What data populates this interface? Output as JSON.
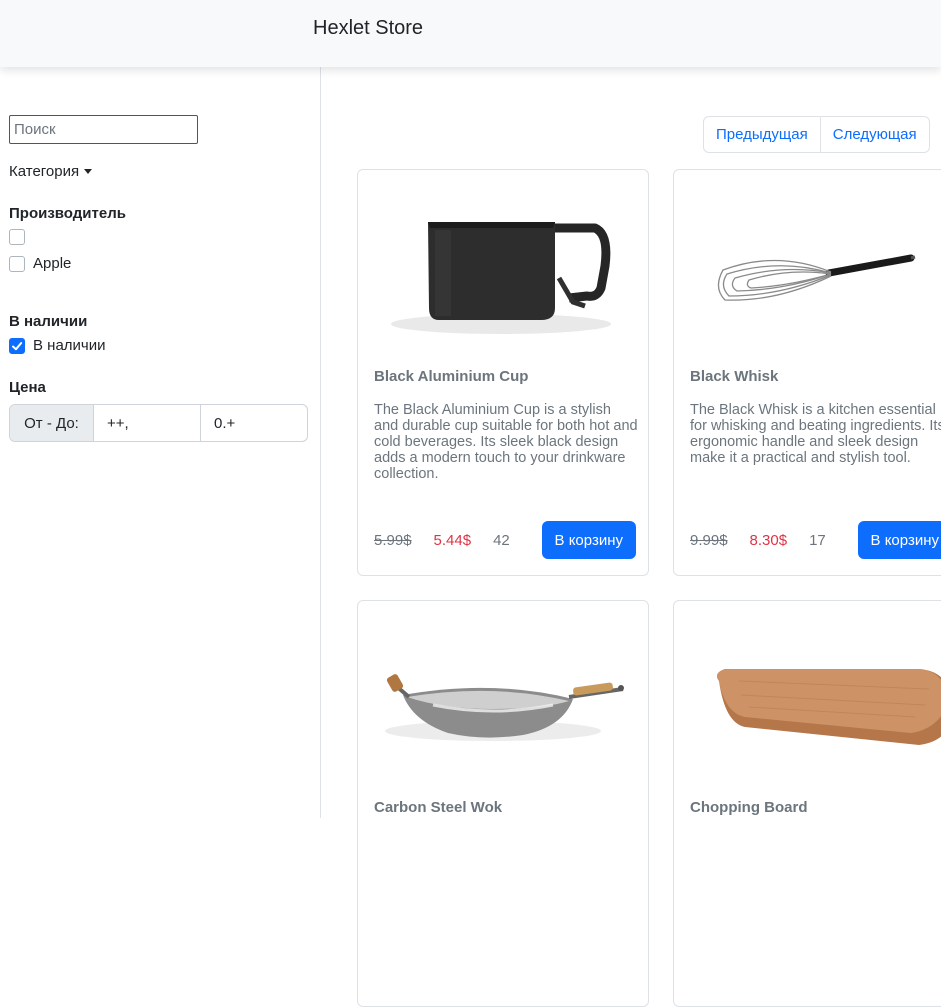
{
  "header": {
    "brand": "Hexlet Store"
  },
  "sidebar": {
    "search_placeholder": "Поиск",
    "category_label": "Категория",
    "manufacturer_title": "Производитель",
    "manufacturers": [
      {
        "label": "",
        "checked": false
      },
      {
        "label": "Apple",
        "checked": false
      }
    ],
    "stock_title": "В наличии",
    "stock_option": {
      "label": "В наличии",
      "checked": true
    },
    "price_title": "Цена",
    "price_label": "От - До:",
    "price_from": "++,",
    "price_to": "0.+"
  },
  "pagination": {
    "prev": "Предыдущая",
    "next": "Следующая"
  },
  "products": [
    {
      "title": "Black Aluminium Cup",
      "description": "The Black Aluminium Cup is a stylish and durable cup suitable for both hot and cold beverages. Its sleek black design adds a modern touch to your drinkware collection.",
      "old_price": "5.99$",
      "new_price": "5.44$",
      "quantity": "42",
      "button": "В корзину",
      "icon": "cup-image"
    },
    {
      "title": "Black Whisk",
      "description": "The Black Whisk is a kitchen essential for whisking and beating ingredients. Its ergonomic handle and sleek design make it a practical and stylish tool.",
      "old_price": "9.99$",
      "new_price": "8.30$",
      "quantity": "17",
      "button": "В корзину",
      "icon": "whisk-image"
    },
    {
      "title": "Carbon Steel Wok",
      "icon": "wok-image"
    },
    {
      "title": "Chopping Board",
      "icon": "board-image"
    }
  ],
  "colors": {
    "accent": "#0d6efd",
    "sale": "#dc3545",
    "muted": "#6c757d"
  }
}
